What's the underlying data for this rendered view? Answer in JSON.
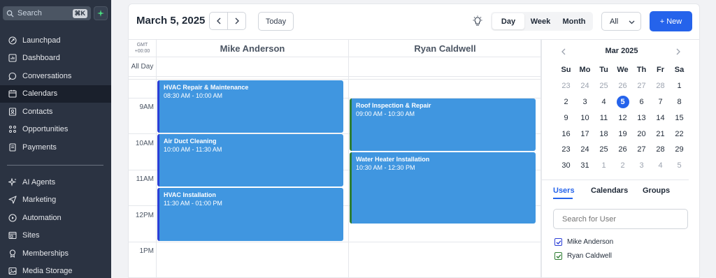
{
  "sidebar": {
    "search_placeholder": "Search",
    "search_shortcut": "⌘K",
    "items": [
      {
        "label": "Launchpad",
        "icon": "rocket-icon"
      },
      {
        "label": "Dashboard",
        "icon": "dashboard-icon"
      },
      {
        "label": "Conversations",
        "icon": "chat-icon"
      },
      {
        "label": "Calendars",
        "icon": "calendar-icon",
        "active": true
      },
      {
        "label": "Contacts",
        "icon": "contacts-icon"
      },
      {
        "label": "Opportunities",
        "icon": "opportunities-icon"
      },
      {
        "label": "Payments",
        "icon": "payments-icon"
      },
      {
        "label": "AI Agents",
        "icon": "sparkles-icon"
      },
      {
        "label": "Marketing",
        "icon": "send-icon"
      },
      {
        "label": "Automation",
        "icon": "automation-icon"
      },
      {
        "label": "Sites",
        "icon": "sites-icon"
      },
      {
        "label": "Memberships",
        "icon": "badge-icon"
      },
      {
        "label": "Media Storage",
        "icon": "image-icon"
      }
    ]
  },
  "toolbar": {
    "date": "March 5, 2025",
    "today_label": "Today",
    "views": [
      "Day",
      "Week",
      "Month"
    ],
    "active_view": "Day",
    "filter_value": "All",
    "new_label": "+ New"
  },
  "calendar": {
    "timezone_line1": "GMT",
    "timezone_line2": "+00:00",
    "all_day_label": "All Day",
    "columns": [
      "Mike Anderson",
      "Ryan Caldwell"
    ],
    "hours": [
      "9AM",
      "10AM",
      "11AM",
      "12PM",
      "1PM"
    ],
    "events": [
      {
        "title": "HVAC Repair & Maintenance",
        "time": "08:30 AM - 10:00 AM",
        "user": "Mike Anderson"
      },
      {
        "title": "Air Duct Cleaning",
        "time": "10:00 AM - 11:30 AM",
        "user": "Mike Anderson"
      },
      {
        "title": "HVAC Installation",
        "time": "11:30 AM - 01:00 PM",
        "user": "Mike Anderson"
      },
      {
        "title": "Roof Inspection & Repair",
        "time": "09:00 AM - 10:30 AM",
        "user": "Ryan Caldwell"
      },
      {
        "title": "Water Heater Installation",
        "time": "10:30 AM - 12:30 PM",
        "user": "Ryan Caldwell"
      }
    ]
  },
  "mini_calendar": {
    "month": "Mar 2025",
    "weekdays": [
      "Su",
      "Mo",
      "Tu",
      "We",
      "Th",
      "Fr",
      "Sa"
    ],
    "selected_day": "5"
  },
  "panel": {
    "tabs": [
      "Users",
      "Calendars",
      "Groups"
    ],
    "active_tab": "Users",
    "search_placeholder": "Search for User",
    "users": [
      {
        "name": "Mike Anderson",
        "color": "#2b3fd6"
      },
      {
        "name": "Ryan Caldwell",
        "color": "#2e7d32"
      }
    ]
  },
  "colors": {
    "accent": "#2563eb",
    "event": "#4096e0",
    "sidebar": "#2b3342"
  }
}
